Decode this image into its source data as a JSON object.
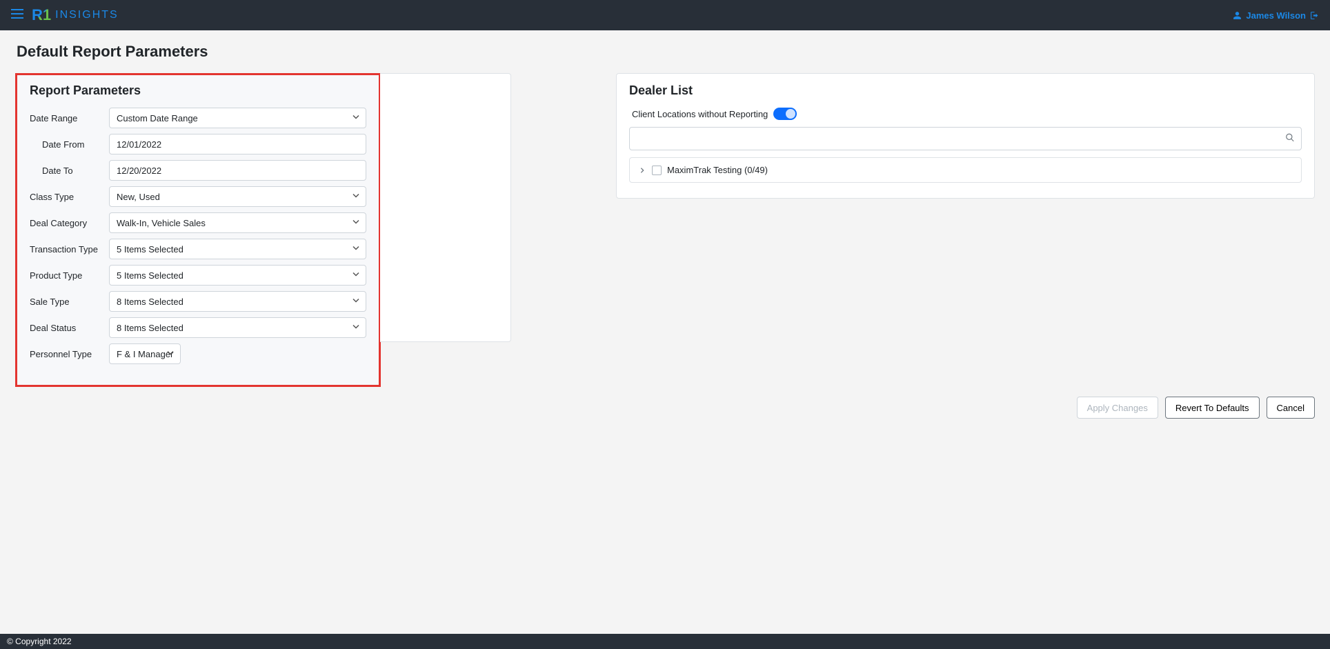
{
  "header": {
    "brand_mark": "R1",
    "brand_text": "INSIGHTS",
    "user_name": "James Wilson"
  },
  "page": {
    "title": "Default Report Parameters"
  },
  "report_params": {
    "panel_title": "Report Parameters",
    "labels": {
      "date_range": "Date Range",
      "date_from": "Date From",
      "date_to": "Date To",
      "class_type": "Class Type",
      "deal_category": "Deal Category",
      "transaction_type": "Transaction Type",
      "product_type": "Product Type",
      "sale_type": "Sale Type",
      "deal_status": "Deal Status",
      "personnel_type": "Personnel Type"
    },
    "values": {
      "date_range": "Custom Date Range",
      "date_from": "12/01/2022",
      "date_to": "12/20/2022",
      "class_type": "New, Used",
      "deal_category": "Walk-In, Vehicle Sales",
      "transaction_type": "5 Items Selected",
      "product_type": "5 Items Selected",
      "sale_type": "8 Items Selected",
      "deal_status": "8 Items Selected",
      "personnel_type": "F & I Manager"
    }
  },
  "dealer_list": {
    "panel_title": "Dealer List",
    "toggle_label": "Client Locations without Reporting",
    "toggle_on": true,
    "search_value": "",
    "tree_item": "MaximTrak Testing (0/49)"
  },
  "buttons": {
    "apply": "Apply Changes",
    "revert": "Revert To Defaults",
    "cancel": "Cancel"
  },
  "footer": {
    "copyright": "© Copyright 2022"
  }
}
